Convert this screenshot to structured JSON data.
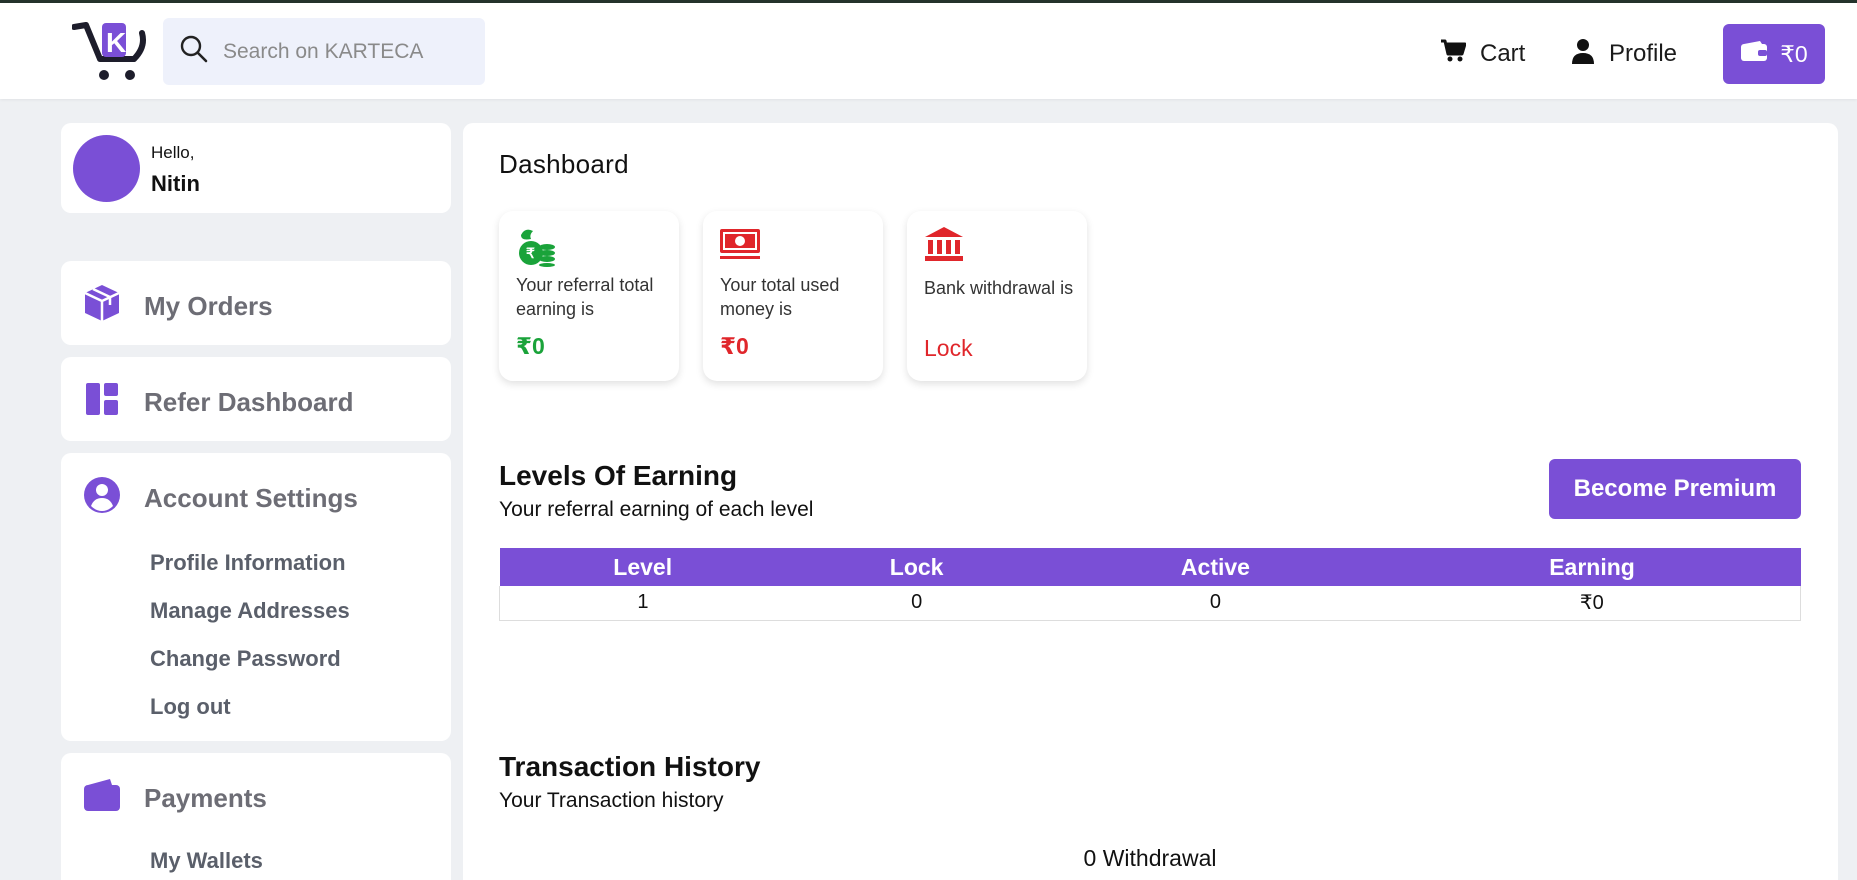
{
  "header": {
    "search_placeholder": "Search on KARTECA",
    "cart_label": "Cart",
    "profile_label": "Profile",
    "wallet_balance": "₹0"
  },
  "user": {
    "greeting": "Hello,",
    "name": "Nitin"
  },
  "sidebar": {
    "my_orders": "My Orders",
    "refer_dashboard": "Refer Dashboard",
    "account_settings": {
      "label": "Account Settings",
      "items": [
        "Profile Information",
        "Manage Addresses",
        "Change Password",
        "Log out"
      ]
    },
    "payments": {
      "label": "Payments",
      "items": [
        "My Wallets"
      ]
    }
  },
  "dashboard": {
    "title": "Dashboard",
    "stats": [
      {
        "label": "Your referral total earning is",
        "value": "₹0",
        "color": "#1aa33a",
        "icon": "money-bag-coins-icon"
      },
      {
        "label": "Your total used money is",
        "value": "₹0",
        "color": "#e0262b",
        "icon": "banknote-icon"
      },
      {
        "label": "Bank withdrawal is",
        "value": "Lock",
        "color": "#e0262b",
        "icon": "bank-icon"
      }
    ]
  },
  "levels": {
    "title": "Levels Of Earning",
    "subtitle": "Your referral earning of each level",
    "premium_button": "Become Premium",
    "columns": [
      "Level",
      "Lock",
      "Active",
      "Earning"
    ],
    "rows": [
      [
        "1",
        "0",
        "0",
        "₹0"
      ]
    ]
  },
  "transactions": {
    "title": "Transaction History",
    "subtitle": "Your Transaction history",
    "withdrawal_summary": "0 Withdrawal"
  },
  "colors": {
    "accent": "#7a4fd6",
    "success": "#1aa33a",
    "danger": "#e0262b"
  }
}
